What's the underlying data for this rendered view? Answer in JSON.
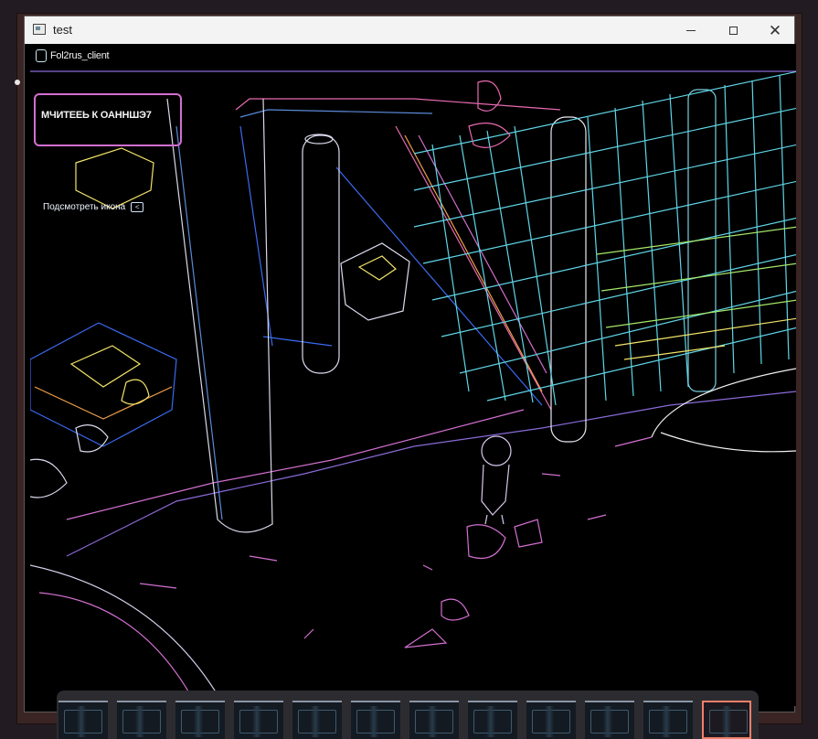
{
  "window": {
    "title": "test",
    "controls": {
      "minimize": "minimize",
      "maximize": "maximize",
      "close": "close"
    }
  },
  "game": {
    "title": "Fol2rus_client",
    "quest_text": "МЧИТЕЕЬ К ОАННШЭ7",
    "hint_text": "Подсмотреть икона",
    "hint_key": "<",
    "colors": {
      "violet": "#d36fd0",
      "blue": "#3a6af0",
      "cyan": "#5fd6e8",
      "green": "#a6e86a",
      "yellow": "#f2e46a",
      "orange": "#f0a04a",
      "pink": "#e86ab0"
    }
  },
  "taskbar_previews": {
    "count": 12,
    "active_index": 11
  }
}
